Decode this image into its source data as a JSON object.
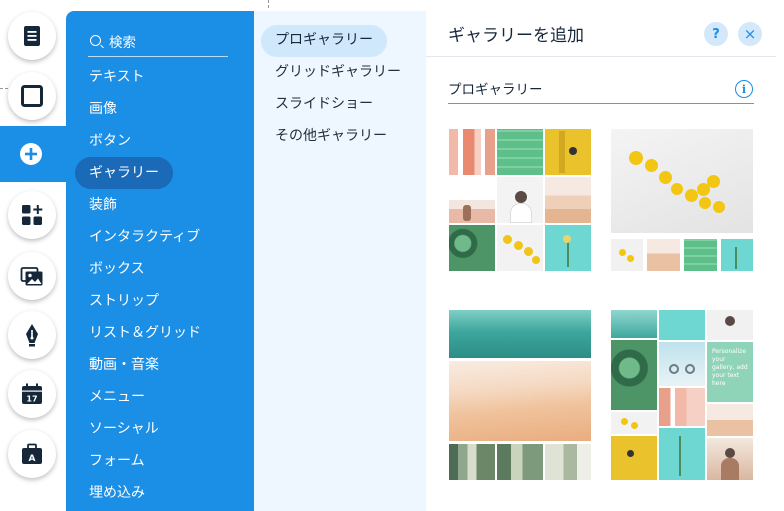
{
  "rail": {
    "items": [
      {
        "name": "pages-icon"
      },
      {
        "name": "background-icon"
      },
      {
        "name": "add-icon"
      },
      {
        "name": "apps-icon"
      },
      {
        "name": "media-icon"
      },
      {
        "name": "blog-pen-icon"
      },
      {
        "name": "bookings-calendar-icon",
        "badge": "17"
      },
      {
        "name": "portfolio-briefcase-icon",
        "badge": "A"
      }
    ]
  },
  "search": {
    "label": "検索"
  },
  "categories": [
    {
      "label": "テキスト"
    },
    {
      "label": "画像"
    },
    {
      "label": "ボタン"
    },
    {
      "label": "ギャラリー",
      "selected": true
    },
    {
      "label": "装飾"
    },
    {
      "label": "インタラクティブ"
    },
    {
      "label": "ボックス"
    },
    {
      "label": "ストリップ"
    },
    {
      "label": "リスト＆グリッド"
    },
    {
      "label": "動画・音楽"
    },
    {
      "label": "メニュー"
    },
    {
      "label": "ソーシャル"
    },
    {
      "label": "フォーム"
    },
    {
      "label": "埋め込み"
    }
  ],
  "subcategories": [
    {
      "label": "プロギャラリー",
      "selected": true
    },
    {
      "label": "グリッドギャラリー"
    },
    {
      "label": "スライドショー"
    },
    {
      "label": "その他ギャラリー"
    }
  ],
  "panel": {
    "title": "ギャラリーを追加",
    "help_label": "?",
    "close_label": "×",
    "section_title": "プロギャラリー",
    "info_label": "i"
  },
  "thumbs": {
    "tile_text": "Personalize your gallery, add your text here"
  },
  "colors": {
    "accent": "#1b8ee6",
    "category_selected": "#1a6ab8",
    "subpanel_bg": "#eef6ff"
  }
}
